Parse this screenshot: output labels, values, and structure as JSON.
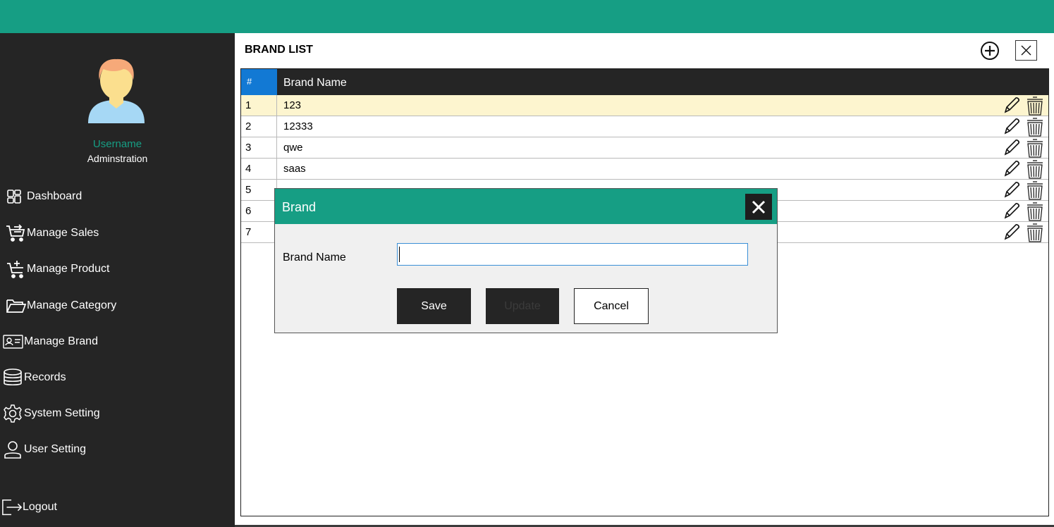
{
  "user": {
    "name": "Username",
    "role": "Adminstration"
  },
  "nav": {
    "items": [
      {
        "label": "Dashboard",
        "icon": "dashboard-icon"
      },
      {
        "label": "Manage Sales",
        "icon": "cart-arrow-icon"
      },
      {
        "label": "Manage Product",
        "icon": "cart-plus-icon"
      },
      {
        "label": "Manage Category",
        "icon": "folder-icon"
      },
      {
        "label": "Manage Brand",
        "icon": "id-card-icon"
      },
      {
        "label": "Records",
        "icon": "database-icon"
      },
      {
        "label": "System Setting",
        "icon": "gear-icon"
      },
      {
        "label": "User Setting",
        "icon": "user-icon"
      }
    ],
    "logout": "Logout"
  },
  "page": {
    "title": "BRAND LIST"
  },
  "table": {
    "headers": [
      "#",
      "Brand Name"
    ],
    "rows": [
      {
        "num": "1",
        "name": "123"
      },
      {
        "num": "2",
        "name": "12333"
      },
      {
        "num": "3",
        "name": "qwe"
      },
      {
        "num": "4",
        "name": "saas"
      },
      {
        "num": "5",
        "name": ""
      },
      {
        "num": "6",
        "name": ""
      },
      {
        "num": "7",
        "name": ""
      }
    ],
    "selected_row": 1
  },
  "dialog": {
    "title": "Brand",
    "field_label": "Brand Name",
    "field_value": "",
    "save_label": "Save",
    "update_label": "Update",
    "cancel_label": "Cancel"
  },
  "colors": {
    "accent": "#169e84",
    "sidebar": "#252525",
    "header_hash": "#1279d4",
    "selected_row": "#fdf5cf"
  }
}
